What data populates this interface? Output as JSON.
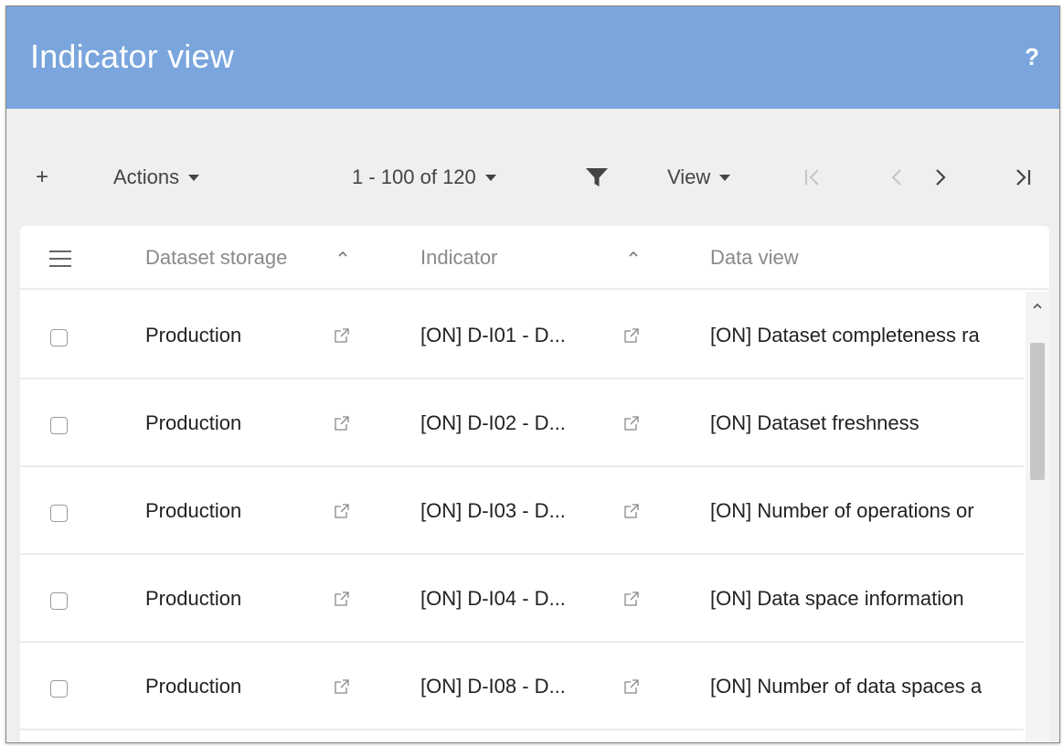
{
  "window": {
    "title": "Indicator view",
    "help_label": "?"
  },
  "toolbar": {
    "add_label": "+",
    "actions_label": "Actions",
    "range_label": "1 - 100 of 120",
    "view_label": "View",
    "first_label": "|<",
    "prev_label": "<",
    "next_label": ">",
    "last_label": ">|",
    "filter_icon": "funnel-icon"
  },
  "grid": {
    "columns": [
      {
        "label": "Dataset storage",
        "sort": "ascending"
      },
      {
        "label": "Indicator",
        "sort": "ascending"
      },
      {
        "label": "Data view"
      }
    ],
    "rows": [
      {
        "storage": "Production",
        "indicator": "[ON] D-I01 - D...",
        "data_view": "[ON] Dataset completeness ra"
      },
      {
        "storage": "Production",
        "indicator": "[ON] D-I02 - D...",
        "data_view": "[ON] Dataset freshness"
      },
      {
        "storage": "Production",
        "indicator": "[ON] D-I03 - D...",
        "data_view": "[ON] Number of operations or"
      },
      {
        "storage": "Production",
        "indicator": "[ON] D-I04 - D...",
        "data_view": "[ON] Data space information"
      },
      {
        "storage": "Production",
        "indicator": "[ON] D-I08 - D...",
        "data_view": "[ON] Number of data spaces a"
      }
    ]
  },
  "colors": {
    "title_bar": "#7aa6dd",
    "toolbar_bg": "#efefef",
    "disabled": "#c4c4c4"
  }
}
